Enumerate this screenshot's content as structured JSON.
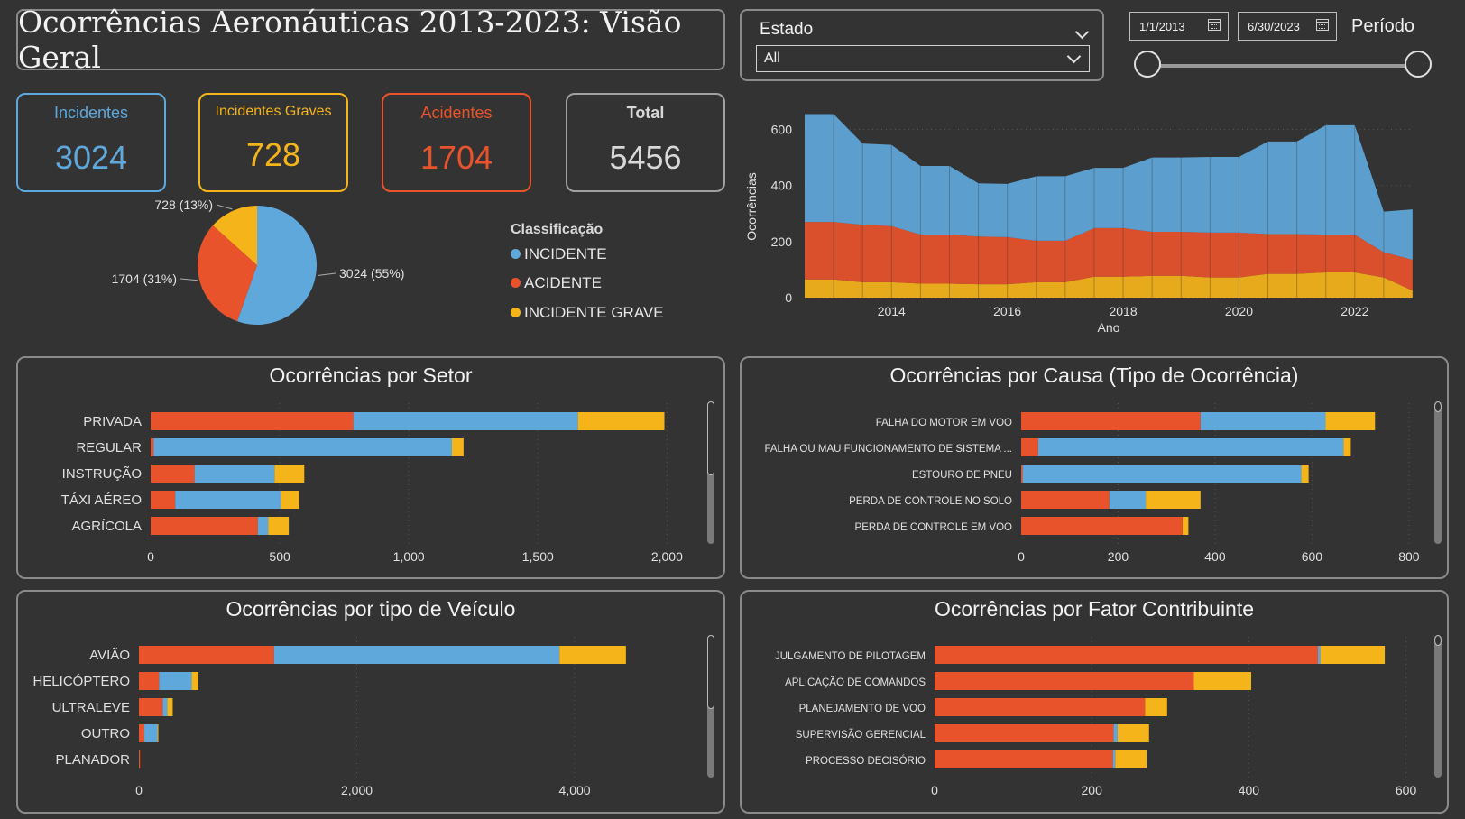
{
  "header": {
    "title": "Ocorrências Aeronáuticas 2013-2023: Visão Geral"
  },
  "filters": {
    "estado_label": "Estado",
    "estado_value": "All",
    "date_start": "1/1/2013",
    "date_end": "6/30/2023",
    "periodo_label": "Período"
  },
  "colors": {
    "incidente": "#5fa8dc",
    "acidente": "#e8532b",
    "grave": "#f5b41a"
  },
  "kpis": [
    {
      "label": "Incidentes",
      "value": "3024",
      "color": "#5fa8dc"
    },
    {
      "label": "Incidentes Graves",
      "value": "728",
      "color": "#f5b41a"
    },
    {
      "label": "Acidentes",
      "value": "1704",
      "color": "#e8532b"
    },
    {
      "label": "Total",
      "value": "5456",
      "color": "#d8d8d8"
    }
  ],
  "legend": {
    "title": "Classificação",
    "items": [
      "INCIDENTE",
      "ACIDENTE",
      "INCIDENTE GRAVE"
    ]
  },
  "chart_data": [
    {
      "type": "pie",
      "id": "classificacao",
      "slices": [
        {
          "label": "INCIDENTE",
          "value": 3024,
          "text": "3024 (55%)"
        },
        {
          "label": "ACIDENTE",
          "value": 1704,
          "text": "1704 (31%)"
        },
        {
          "label": "INCIDENTE GRAVE",
          "value": 728,
          "text": "728 (13%)"
        }
      ]
    },
    {
      "type": "area",
      "id": "por_ano",
      "ylabel": "Ocorrências",
      "xlabel": "Ano",
      "ylim": [
        0,
        650
      ],
      "yticks": [
        0,
        200,
        400,
        600
      ],
      "xticks": [
        2014,
        2016,
        2018,
        2020,
        2022
      ],
      "x": [
        2013.0,
        2013.5,
        2014.0,
        2014.5,
        2015.0,
        2015.5,
        2016.0,
        2016.5,
        2017.0,
        2017.5,
        2018.0,
        2018.5,
        2019.0,
        2019.5,
        2020.0,
        2020.5,
        2021.0,
        2021.5,
        2022.0,
        2022.5,
        2023.0,
        2023.5
      ],
      "series": [
        {
          "name": "INCIDENTE GRAVE",
          "values": [
            65,
            65,
            55,
            55,
            50,
            50,
            48,
            48,
            55,
            55,
            75,
            75,
            78,
            78,
            72,
            72,
            85,
            85,
            90,
            90,
            72,
            25
          ]
        },
        {
          "name": "ACIDENTE",
          "values": [
            205,
            205,
            205,
            200,
            175,
            175,
            170,
            168,
            148,
            148,
            173,
            173,
            157,
            157,
            160,
            160,
            142,
            142,
            135,
            135,
            90,
            110
          ]
        },
        {
          "name": "INCIDENTE",
          "values": [
            385,
            385,
            290,
            290,
            245,
            245,
            190,
            190,
            230,
            230,
            215,
            215,
            265,
            265,
            270,
            270,
            330,
            330,
            390,
            390,
            145,
            180
          ]
        }
      ]
    },
    {
      "type": "bar",
      "id": "setor",
      "title": "Ocorrências por Setor",
      "categories": [
        "PRIVADA",
        "REGULAR",
        "INSTRUÇÃO",
        "TÁXI AÉREO",
        "AGRÍCOLA"
      ],
      "xlim": [
        0,
        2100
      ],
      "xticks": [
        0,
        500,
        1000,
        1500,
        2000
      ],
      "xtick_labels": [
        "0",
        "500",
        "1,000",
        "1,500",
        "2,000"
      ],
      "series": [
        {
          "name": "ACIDENTE",
          "values": [
            785,
            12,
            170,
            95,
            415
          ]
        },
        {
          "name": "INCIDENTE",
          "values": [
            870,
            1155,
            310,
            410,
            40
          ]
        },
        {
          "name": "INCIDENTE GRAVE",
          "values": [
            335,
            45,
            115,
            70,
            80
          ]
        }
      ]
    },
    {
      "type": "bar",
      "id": "causa",
      "title": "Ocorrências por Causa (Tipo de Ocorrência)",
      "categories": [
        "FALHA DO MOTOR EM VOO",
        "FALHA OU MAU FUNCIONAMENTO DE SISTEMA ...",
        "ESTOURO DE PNEU",
        "PERDA DE CONTROLE NO SOLO",
        "PERDA DE CONTROLE EM VOO"
      ],
      "xlim": [
        0,
        830
      ],
      "xticks": [
        0,
        200,
        400,
        600,
        800
      ],
      "xtick_labels": [
        "0",
        "200",
        "400",
        "600",
        "800"
      ],
      "series": [
        {
          "name": "ACIDENTE",
          "values": [
            370,
            35,
            3,
            182,
            333
          ]
        },
        {
          "name": "INCIDENTE",
          "values": [
            258,
            630,
            575,
            75,
            0
          ]
        },
        {
          "name": "INCIDENTE GRAVE",
          "values": [
            102,
            15,
            15,
            113,
            12
          ]
        }
      ]
    },
    {
      "type": "bar",
      "id": "veiculo",
      "title": "Ocorrências por tipo de Veículo",
      "categories": [
        "AVIÃO",
        "HELICÓPTERO",
        "ULTRALEVE",
        "OUTRO",
        "PLANADOR"
      ],
      "xlim": [
        0,
        5200
      ],
      "xticks": [
        0,
        2000,
        4000
      ],
      "xtick_labels": [
        "0",
        "2,000",
        "4,000"
      ],
      "series": [
        {
          "name": "ACIDENTE",
          "values": [
            1240,
            185,
            220,
            50,
            10
          ]
        },
        {
          "name": "INCIDENTE",
          "values": [
            2620,
            300,
            40,
            120,
            0
          ]
        },
        {
          "name": "INCIDENTE GRAVE",
          "values": [
            610,
            60,
            50,
            5,
            0
          ]
        }
      ]
    },
    {
      "type": "bar",
      "id": "fator",
      "title": "Ocorrências por Fator Contribuinte",
      "categories": [
        "JULGAMENTO DE PILOTAGEM",
        "APLICAÇÃO DE COMANDOS",
        "PLANEJAMENTO DE VOO",
        "SUPERVISÃO GERENCIAL",
        "PROCESSO DECISÓRIO"
      ],
      "xlim": [
        0,
        620
      ],
      "xticks": [
        0,
        200,
        400,
        600
      ],
      "xtick_labels": [
        "0",
        "200",
        "400",
        "600"
      ],
      "series": [
        {
          "name": "ACIDENTE",
          "values": [
            488,
            330,
            268,
            228,
            227
          ]
        },
        {
          "name": "INCIDENTE",
          "values": [
            3,
            0,
            0,
            5,
            3
          ]
        },
        {
          "name": "INCIDENTE GRAVE",
          "values": [
            82,
            73,
            28,
            40,
            40
          ]
        }
      ]
    }
  ]
}
